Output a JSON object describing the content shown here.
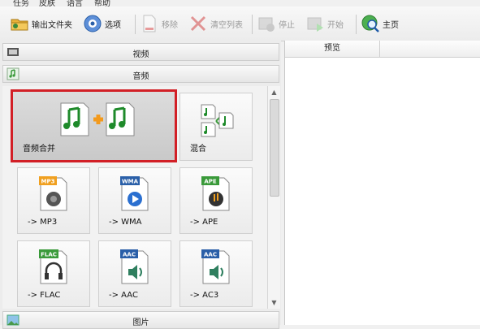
{
  "menu": {
    "items": [
      "任务",
      "皮肤",
      "语言",
      "帮助"
    ]
  },
  "toolbar": {
    "output_folder": "输出文件夹",
    "options": "选项",
    "remove": "移除",
    "clear_list": "清空列表",
    "stop": "停止",
    "start": "开始",
    "home": "主页"
  },
  "categories": {
    "video": "视频",
    "audio": "音频",
    "image": "图片"
  },
  "tiles": [
    {
      "label": "音频合并",
      "icon": "audio-join-icon",
      "selected": true
    },
    {
      "label": "混合",
      "icon": "audio-mix-icon"
    },
    {
      "label": "-> MP3",
      "icon": "mp3-speaker-icon",
      "badge": "MP3"
    },
    {
      "label": "-> WMA",
      "icon": "wma-play-icon",
      "badge": "WMA"
    },
    {
      "label": "-> APE",
      "icon": "ape-music-icon",
      "badge": "APE"
    },
    {
      "label": "-> FLAC",
      "icon": "flac-headphones-icon",
      "badge": "FLAC"
    },
    {
      "label": "-> AAC",
      "icon": "aac-speaker-icon",
      "badge": "AAC"
    },
    {
      "label": "-> AC3",
      "icon": "ac3-speaker-icon",
      "badge": "AAC"
    }
  ],
  "preview": {
    "column_header": "预览"
  },
  "colors": {
    "selected_border": "#d21f26",
    "badge_orange": "#f0a020",
    "badge_blue": "#2a5fa8",
    "badge_green": "#3a9a3a",
    "badge_teal": "#2f7f5f"
  }
}
